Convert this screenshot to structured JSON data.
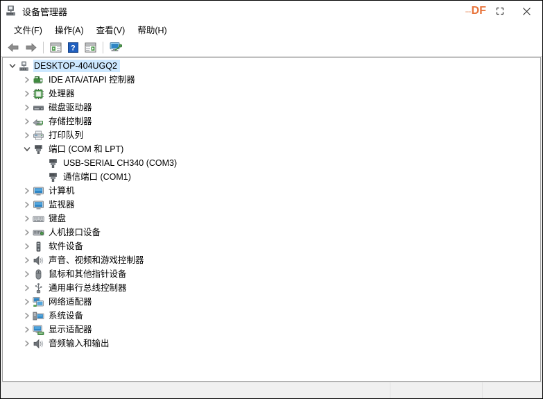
{
  "window": {
    "title": "设备管理器",
    "app_icon": "device-manager-icon",
    "watermark": "DF",
    "watermark_dash": "--",
    "controls": {
      "maximize": "maximize-icon",
      "close": "close-icon"
    }
  },
  "menubar": {
    "items": [
      {
        "label": "文件(F)",
        "name": "menu-file"
      },
      {
        "label": "操作(A)",
        "name": "menu-action"
      },
      {
        "label": "查看(V)",
        "name": "menu-view"
      },
      {
        "label": "帮助(H)",
        "name": "menu-help"
      }
    ]
  },
  "toolbar": {
    "buttons": [
      {
        "name": "back-arrow-icon",
        "tooltip": "后退"
      },
      {
        "name": "forward-arrow-icon",
        "tooltip": "前进"
      },
      {
        "name": "show-hide-console-tree-icon",
        "tooltip": "显示/隐藏控制台树"
      },
      {
        "name": "help-icon",
        "tooltip": "帮助"
      },
      {
        "name": "properties-icon",
        "tooltip": "属性"
      },
      {
        "name": "scan-hardware-changes-icon",
        "tooltip": "扫描检测硬件改动"
      }
    ]
  },
  "tree": {
    "root": {
      "label": "DESKTOP-404UGQ2",
      "icon": "computer-node-icon",
      "expanded": true,
      "selected": true
    },
    "items": [
      {
        "label": "IDE ATA/ATAPI 控制器",
        "icon": "ide-controller-icon",
        "level": 1,
        "expanded": false
      },
      {
        "label": "处理器",
        "icon": "processor-icon",
        "level": 1,
        "expanded": false
      },
      {
        "label": "磁盘驱动器",
        "icon": "disk-drive-icon",
        "level": 1,
        "expanded": false
      },
      {
        "label": "存储控制器",
        "icon": "storage-controller-icon",
        "level": 1,
        "expanded": false
      },
      {
        "label": "打印队列",
        "icon": "printer-icon",
        "level": 1,
        "expanded": false
      },
      {
        "label": "端口 (COM 和 LPT)",
        "icon": "port-icon",
        "level": 1,
        "expanded": true
      },
      {
        "label": "USB-SERIAL CH340 (COM3)",
        "icon": "port-icon",
        "level": 2,
        "expanded": null
      },
      {
        "label": "通信端口 (COM1)",
        "icon": "port-icon",
        "level": 2,
        "expanded": null
      },
      {
        "label": "计算机",
        "icon": "monitor-icon",
        "level": 1,
        "expanded": false
      },
      {
        "label": "监视器",
        "icon": "monitor-icon",
        "level": 1,
        "expanded": false
      },
      {
        "label": "键盘",
        "icon": "keyboard-icon",
        "level": 1,
        "expanded": false
      },
      {
        "label": "人机接口设备",
        "icon": "hid-icon",
        "level": 1,
        "expanded": false
      },
      {
        "label": "软件设备",
        "icon": "software-device-icon",
        "level": 1,
        "expanded": false
      },
      {
        "label": "声音、视频和游戏控制器",
        "icon": "speaker-icon",
        "level": 1,
        "expanded": false
      },
      {
        "label": "鼠标和其他指针设备",
        "icon": "mouse-icon",
        "level": 1,
        "expanded": false
      },
      {
        "label": "通用串行总线控制器",
        "icon": "usb-icon",
        "level": 1,
        "expanded": false
      },
      {
        "label": "网络适配器",
        "icon": "network-adapter-icon",
        "level": 1,
        "expanded": false
      },
      {
        "label": "系统设备",
        "icon": "system-device-icon",
        "level": 1,
        "expanded": false
      },
      {
        "label": "显示适配器",
        "icon": "display-adapter-icon",
        "level": 1,
        "expanded": false
      },
      {
        "label": "音频输入和输出",
        "icon": "speaker-icon",
        "level": 1,
        "expanded": false
      }
    ]
  },
  "statusbar": {
    "main_text": "",
    "cell_b_text": "",
    "cell_c_text": ""
  },
  "colors": {
    "selection": "#cce8ff",
    "watermark": "#e8743b",
    "icon_green": "#3f8a3f",
    "icon_blue": "#3a9ad9",
    "chevron": "#9a9a9a",
    "panel_border": "#a0a0a0"
  }
}
